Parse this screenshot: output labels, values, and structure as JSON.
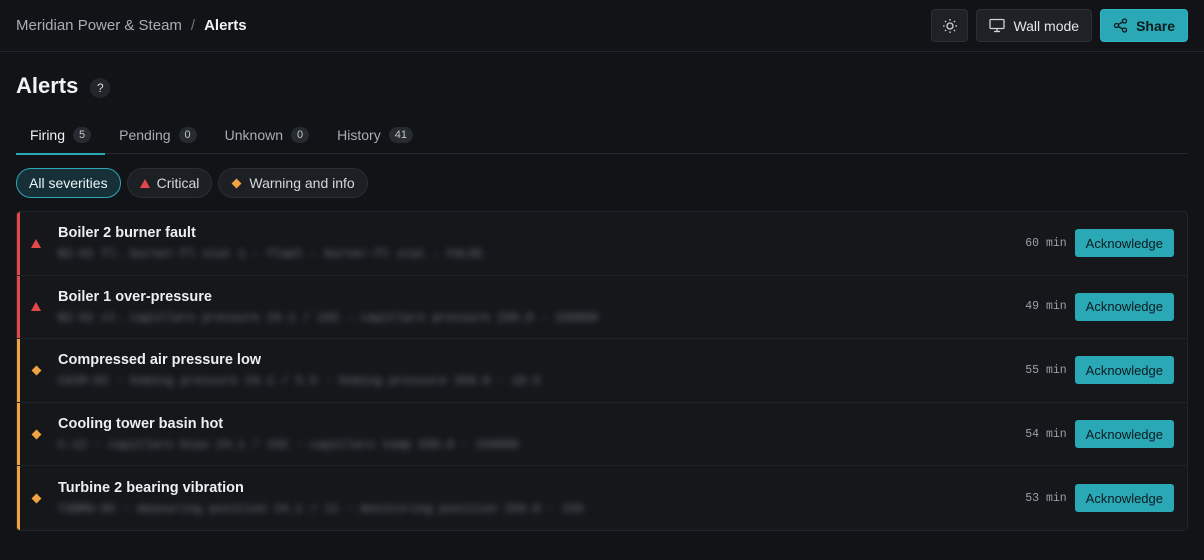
{
  "breadcrumb": {
    "org": "Meridian Power & Steam",
    "separator": "/",
    "current": "Alerts"
  },
  "toolbar": {
    "theme_icon": "sun-icon",
    "wall_mode_label": "Wall mode",
    "wall_mode_icon": "monitor-icon",
    "share_label": "Share",
    "share_icon": "share-icon"
  },
  "page": {
    "title": "Alerts",
    "help_label": "?"
  },
  "tabs": [
    {
      "label": "Firing",
      "count": "5",
      "active": true
    },
    {
      "label": "Pending",
      "count": "0"
    },
    {
      "label": "Unknown",
      "count": "0"
    },
    {
      "label": "History",
      "count": "41"
    }
  ],
  "filters": [
    {
      "label": "All severities",
      "active": true
    },
    {
      "label": "Critical",
      "icon": "triangle-icon"
    },
    {
      "label": "Warning and info",
      "icon": "diamond-icon"
    }
  ],
  "colors": {
    "accent": "#2aa8b6",
    "critical": "#e54848",
    "warning": "#f0a340"
  },
  "alerts": [
    {
      "name": "Boiler 2 burner fault",
      "detail": "B2-01 fl. burner-fl stat 1 - flaml - burner-fl stat - FALSE",
      "age": "60 min",
      "severity": "critical",
      "action": "Acknowledge"
    },
    {
      "name": "Boiler 1 over-pressure",
      "detail": "B2-01 ct. capitlaro pressure 24.1 / 192 - capitlaro pressure 250.0 - 150000",
      "age": "49 min",
      "severity": "critical",
      "action": "Acknowledge"
    },
    {
      "name": "Compressed air pressure low",
      "detail": "CAIR-02 - homing pressure 24.1 / 5.5 - homing pressure 250.0 - 10.5",
      "age": "55 min",
      "severity": "warning",
      "action": "Acknowledge"
    },
    {
      "name": "Cooling tower basin hot",
      "detail": "C-12 - capitlaro bias 24.1 / 192 - capitlaro temp 250.0 - 150000",
      "age": "54 min",
      "severity": "warning",
      "action": "Acknowledge"
    },
    {
      "name": "Turbine 2 bearing vibration",
      "detail": "T2BRG-02 - measuring position 24.1 / 11 - monitoring position 250.0 - 155",
      "age": "53 min",
      "severity": "warning",
      "action": "Acknowledge"
    }
  ]
}
